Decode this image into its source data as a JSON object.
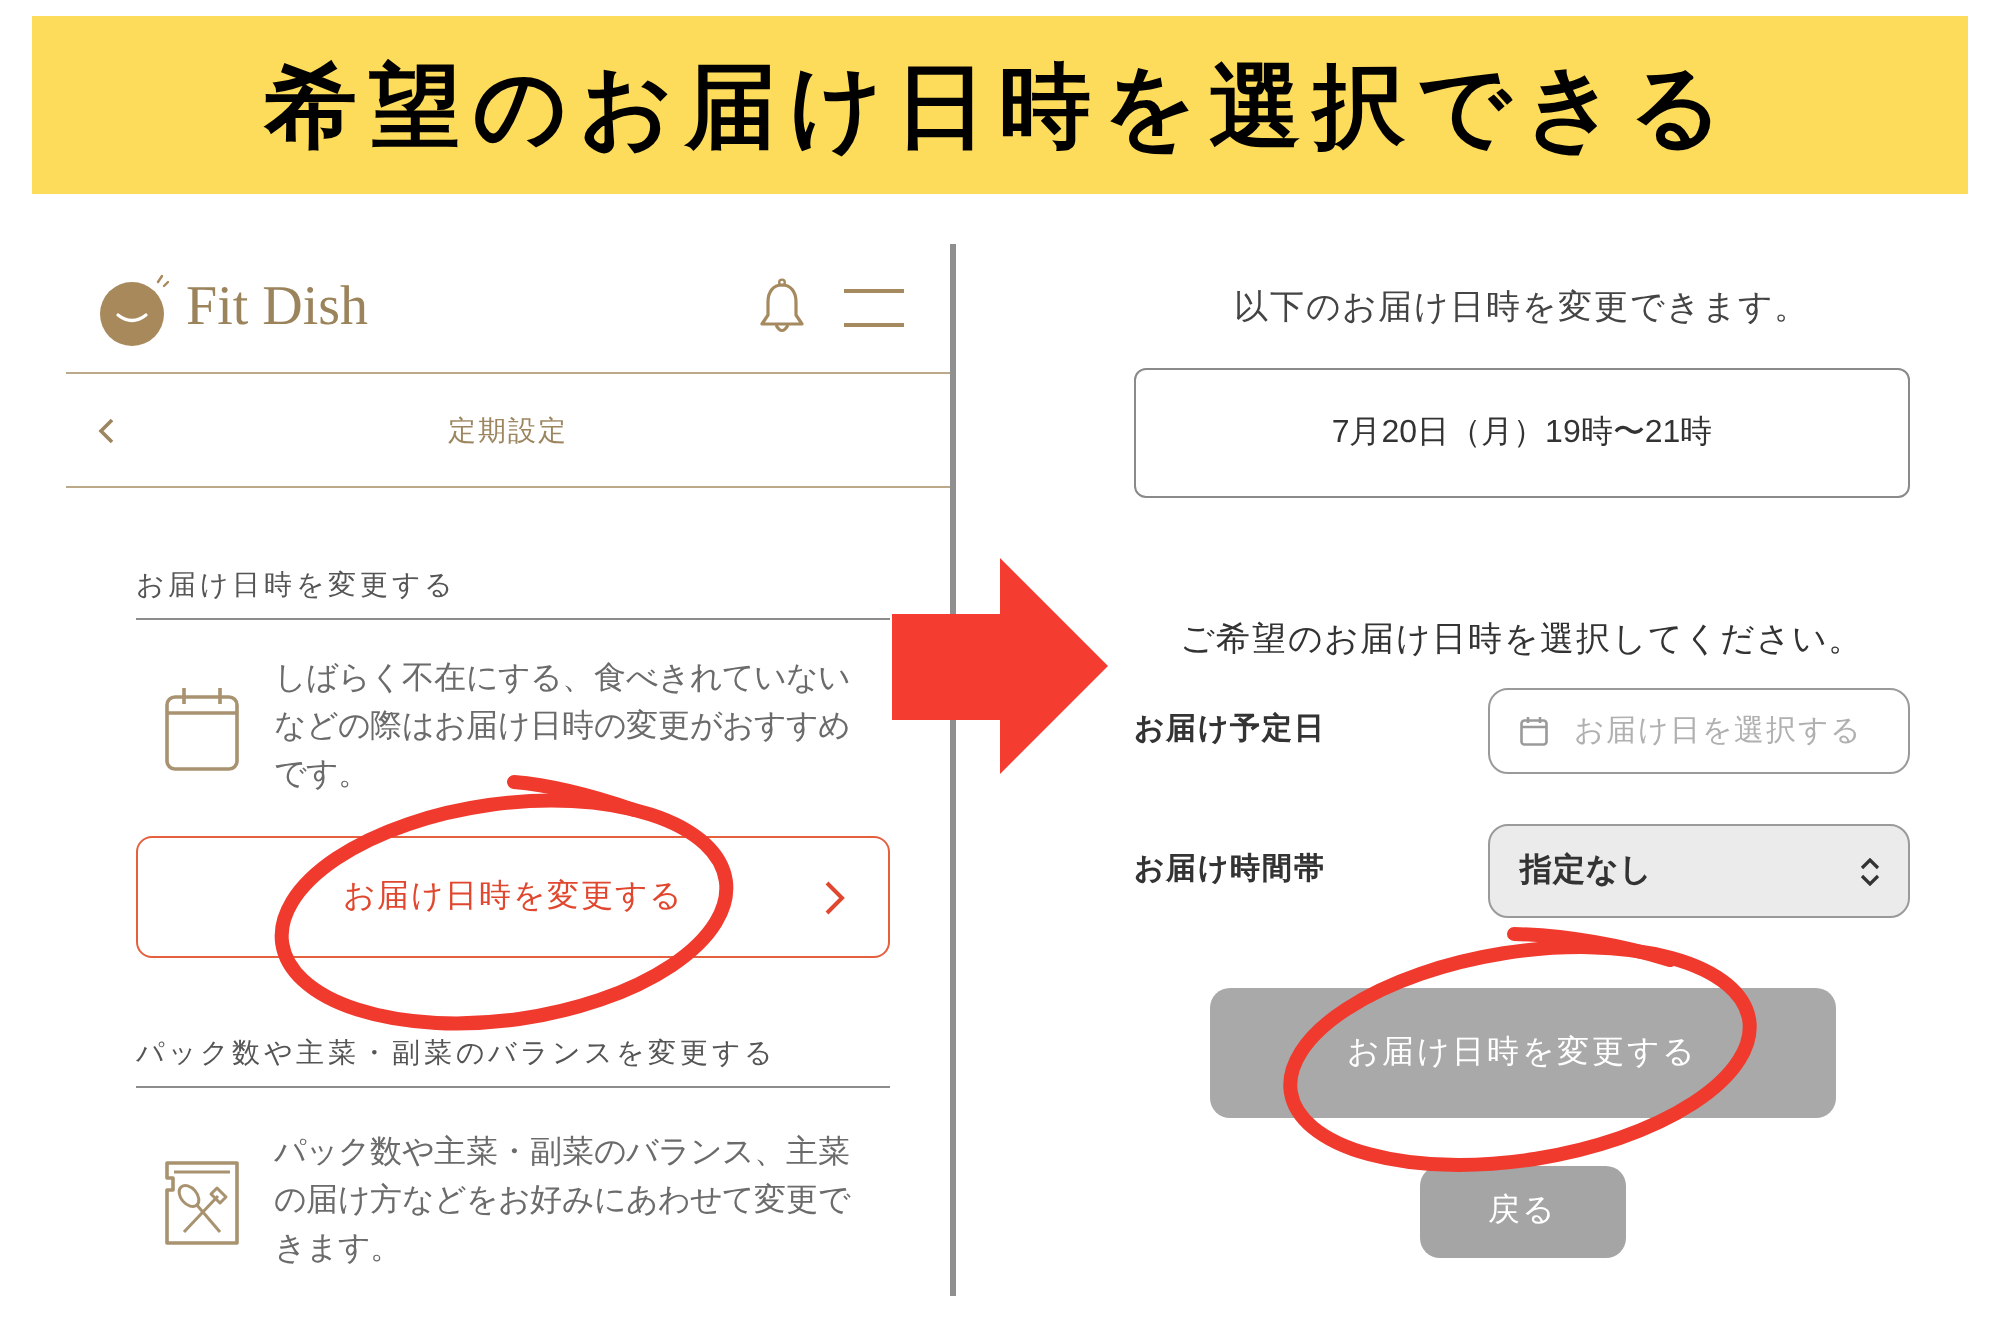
{
  "banner": {
    "title": "希望のお届け日時を選択できる"
  },
  "left_screen": {
    "header": {
      "logo_text": "Fit Dish"
    },
    "nav": {
      "title": "定期設定"
    },
    "sections": [
      {
        "heading": "お届け日時を変更する",
        "description": "しばらく不在にする、食べきれていないなどの際はお届け日時の変更がおすすめです。",
        "button": {
          "label": "お届け日時を変更する"
        }
      },
      {
        "heading": "パック数や主菜・副菜のバランスを変更する",
        "description": "パック数や主菜・副菜のバランス、主菜の届け方などをお好みにあわせて変更できます。"
      }
    ]
  },
  "right_screen": {
    "intro": "以下のお届け日時を変更できます。",
    "current_slot": "7月20日（月）19時〜21時",
    "prompt": "ご希望のお届け日時を選択してください。",
    "fields": [
      {
        "kind": "date",
        "label": "お届け予定日",
        "placeholder": "お届け日を選択する"
      },
      {
        "kind": "select",
        "label": "お届け時間帯",
        "value": "指定なし"
      }
    ],
    "submit_button": {
      "label": "お届け日時を変更する"
    },
    "back_button": {
      "label": "戻る"
    }
  }
}
